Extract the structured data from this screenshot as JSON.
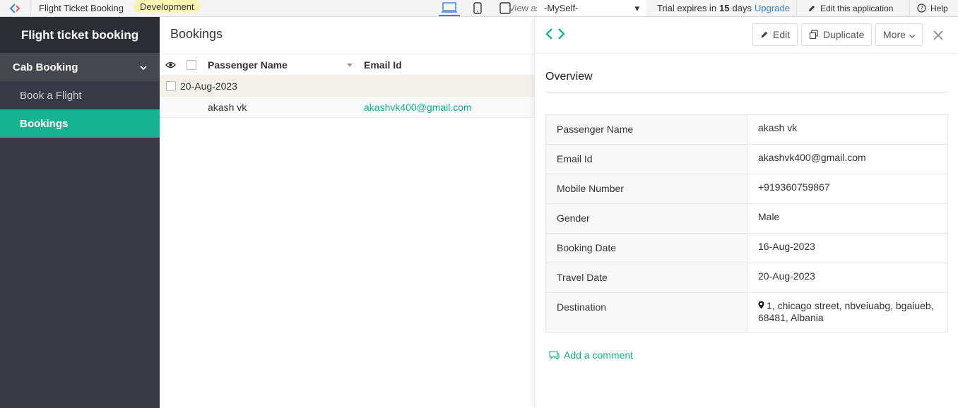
{
  "topbar": {
    "app_name": "Flight Ticket Booking",
    "env_badge": "Development",
    "view_as_label": "View as",
    "view_as_value": "-MySelf-",
    "trial_text": "Trial expires in",
    "trial_days": "15",
    "trial_unit": "days",
    "upgrade_label": "Upgrade",
    "edit_app_label": "Edit this application",
    "help_label": "Help"
  },
  "sidebar": {
    "title": "Flight ticket booking",
    "section": "Cab Booking",
    "items": [
      {
        "label": "Book a Flight"
      },
      {
        "label": "Bookings"
      }
    ]
  },
  "main": {
    "title": "Bookings",
    "columns": [
      "Passenger Name",
      "Email Id"
    ],
    "group_label": "20-Aug-2023",
    "rows": [
      {
        "passenger": "akash vk",
        "email": "akashvk400@gmail.com"
      }
    ]
  },
  "panel": {
    "edit_label": "Edit",
    "duplicate_label": "Duplicate",
    "more_label": "More",
    "overview_title": "Overview",
    "fields": [
      {
        "label": "Passenger Name",
        "value": "akash vk"
      },
      {
        "label": "Email Id",
        "value": "akashvk400@gmail.com"
      },
      {
        "label": "Mobile Number",
        "value": "+919360759867"
      },
      {
        "label": "Gender",
        "value": "Male"
      },
      {
        "label": "Booking Date",
        "value": "16-Aug-2023"
      },
      {
        "label": "Travel Date",
        "value": "20-Aug-2023"
      },
      {
        "label": "Destination",
        "value": "1, chicago street, nbveiuabg, bgaiueb, 68481, Albania"
      }
    ],
    "add_comment_label": "Add a comment"
  },
  "colors": {
    "accent": "#17b292",
    "sidebar_bg": "#383a45",
    "link": "#3b7fd4"
  }
}
